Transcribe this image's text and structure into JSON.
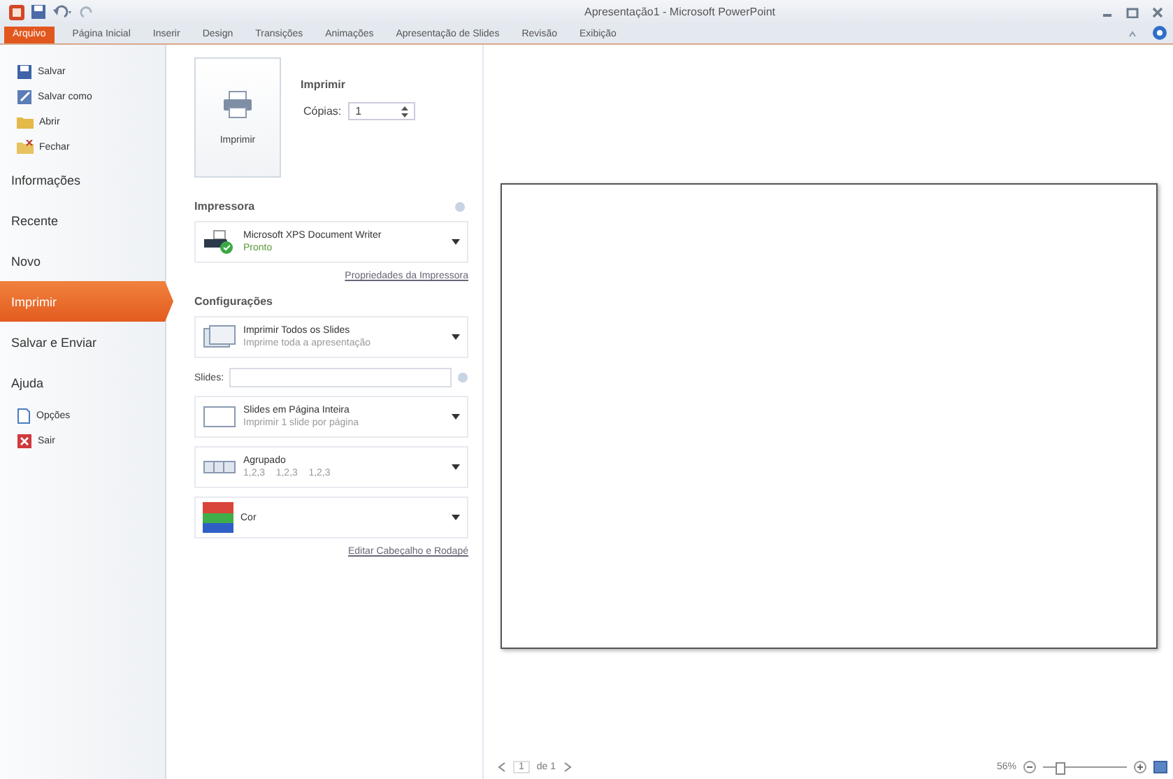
{
  "window": {
    "title": "Apresentação1 - Microsoft PowerPoint"
  },
  "tabs": [
    {
      "label": "Arquivo",
      "selected": true
    },
    {
      "label": "Página Inicial",
      "selected": false
    },
    {
      "label": "Inserir",
      "selected": false
    },
    {
      "label": "Design",
      "selected": false
    },
    {
      "label": "Transições",
      "selected": false
    },
    {
      "label": "Animações",
      "selected": false
    },
    {
      "label": "Apresentação de Slides",
      "selected": false
    },
    {
      "label": "Revisão",
      "selected": false
    },
    {
      "label": "Exibição",
      "selected": false
    }
  ],
  "sidebar": {
    "items": [
      {
        "label": "Salvar",
        "kind": "command",
        "selected": false
      },
      {
        "label": "Salvar como",
        "kind": "command",
        "selected": false
      },
      {
        "label": "Abrir",
        "kind": "command",
        "selected": false
      },
      {
        "label": "Fechar",
        "kind": "command",
        "selected": false
      },
      {
        "label": "Informações",
        "kind": "section",
        "selected": false
      },
      {
        "label": "Recente",
        "kind": "section",
        "selected": false
      },
      {
        "label": "Novo",
        "kind": "section",
        "selected": false
      },
      {
        "label": "Imprimir",
        "kind": "section",
        "selected": true
      },
      {
        "label": "Salvar e Enviar",
        "kind": "section",
        "selected": false
      },
      {
        "label": "Ajuda",
        "kind": "section",
        "selected": false
      },
      {
        "label": "Opções",
        "kind": "command",
        "selected": false
      },
      {
        "label": "Sair",
        "kind": "command",
        "selected": false
      }
    ]
  },
  "print": {
    "button": "Imprimir",
    "heading": "Imprimir",
    "copies_label": "Cópias:",
    "copies": "1"
  },
  "printer": {
    "heading": "Impressora",
    "name": "Microsoft XPS Document Writer",
    "status": "Pronto",
    "link": "Propriedades da Impressora"
  },
  "settings": {
    "heading": "Configurações",
    "options": [
      {
        "kind": "dropdown",
        "title": "Imprimir Todos os Slides",
        "subtitle": "Imprime toda a apresentação"
      },
      {
        "kind": "field",
        "label": "Slides:"
      },
      {
        "kind": "dropdown",
        "title": "Slides em Página Inteira",
        "subtitle": "Imprimir 1 slide por página"
      },
      {
        "kind": "dropdown",
        "title": "Agrupado",
        "subtitle": "1,2,3    1,2,3    1,2,3"
      },
      {
        "kind": "dropdown",
        "title": "Cor"
      }
    ],
    "link": "Editar Cabeçalho e Rodapé"
  },
  "preview": {
    "page": "1",
    "of": "de 1",
    "zoom": "56%",
    "zoom_slider": {
      "level": 0.2
    }
  }
}
